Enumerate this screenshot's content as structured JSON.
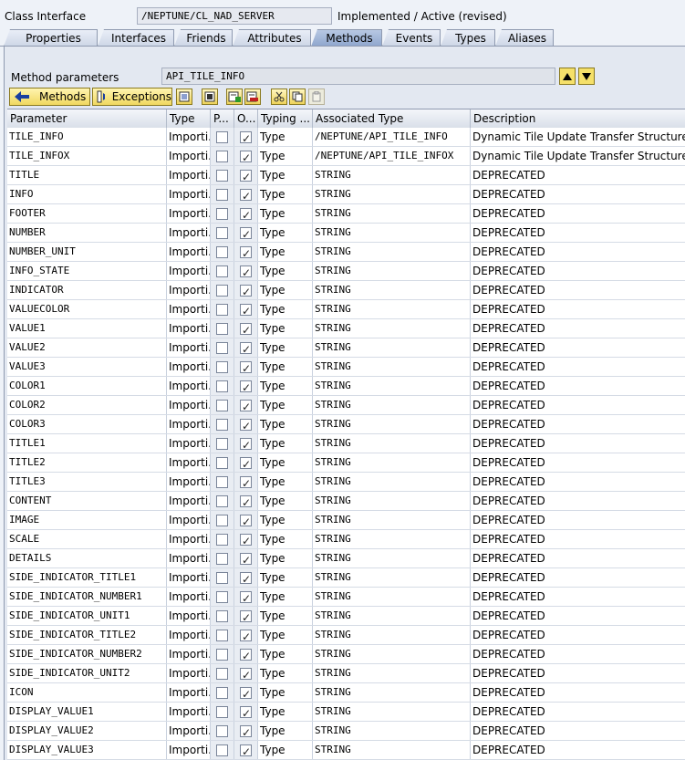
{
  "header": {
    "class_label": "Class Interface",
    "class_value": "/NEPTUNE/CL_NAD_SERVER",
    "status": "Implemented / Active (revised)"
  },
  "tabs": [
    {
      "label": "Properties"
    },
    {
      "label": "Interfaces"
    },
    {
      "label": "Friends"
    },
    {
      "label": "Attributes"
    },
    {
      "label": "Methods",
      "active": true
    },
    {
      "label": "Events"
    },
    {
      "label": "Types"
    },
    {
      "label": "Aliases"
    }
  ],
  "method_params": {
    "label": "Method parameters",
    "value": "API_TILE_INFO"
  },
  "toolbar": {
    "methods_label": "Methods",
    "exceptions_label": "Exceptions"
  },
  "columns": [
    "Parameter",
    "Type",
    "P...",
    "O...",
    "Typing ...",
    "Associated Type",
    "Description"
  ],
  "rows": [
    {
      "p": "TILE_INFO",
      "t": "Importi...",
      "pass": false,
      "opt": true,
      "typing": "Type",
      "assoc": "/NEPTUNE/API_TILE_INFO",
      "desc": "Dynamic Tile Update Transfer Structure"
    },
    {
      "p": "TILE_INFOX",
      "t": "Importi...",
      "pass": false,
      "opt": true,
      "typing": "Type",
      "assoc": "/NEPTUNE/API_TILE_INFOX",
      "desc": "Dynamic Tile Update Transfer Structure"
    },
    {
      "p": "TITLE",
      "t": "Importi...",
      "pass": false,
      "opt": true,
      "typing": "Type",
      "assoc": "STRING",
      "desc": "DEPRECATED"
    },
    {
      "p": "INFO",
      "t": "Importi...",
      "pass": false,
      "opt": true,
      "typing": "Type",
      "assoc": "STRING",
      "desc": "DEPRECATED"
    },
    {
      "p": "FOOTER",
      "t": "Importi...",
      "pass": false,
      "opt": true,
      "typing": "Type",
      "assoc": "STRING",
      "desc": "DEPRECATED"
    },
    {
      "p": "NUMBER",
      "t": "Importi...",
      "pass": false,
      "opt": true,
      "typing": "Type",
      "assoc": "STRING",
      "desc": "DEPRECATED"
    },
    {
      "p": "NUMBER_UNIT",
      "t": "Importi...",
      "pass": false,
      "opt": true,
      "typing": "Type",
      "assoc": "STRING",
      "desc": "DEPRECATED"
    },
    {
      "p": "INFO_STATE",
      "t": "Importi...",
      "pass": false,
      "opt": true,
      "typing": "Type",
      "assoc": "STRING",
      "desc": "DEPRECATED"
    },
    {
      "p": "INDICATOR",
      "t": "Importi...",
      "pass": false,
      "opt": true,
      "typing": "Type",
      "assoc": "STRING",
      "desc": "DEPRECATED"
    },
    {
      "p": "VALUECOLOR",
      "t": "Importi...",
      "pass": false,
      "opt": true,
      "typing": "Type",
      "assoc": "STRING",
      "desc": "DEPRECATED"
    },
    {
      "p": "VALUE1",
      "t": "Importi...",
      "pass": false,
      "opt": true,
      "typing": "Type",
      "assoc": "STRING",
      "desc": "DEPRECATED"
    },
    {
      "p": "VALUE2",
      "t": "Importi...",
      "pass": false,
      "opt": true,
      "typing": "Type",
      "assoc": "STRING",
      "desc": "DEPRECATED"
    },
    {
      "p": "VALUE3",
      "t": "Importi...",
      "pass": false,
      "opt": true,
      "typing": "Type",
      "assoc": "STRING",
      "desc": "DEPRECATED"
    },
    {
      "p": "COLOR1",
      "t": "Importi...",
      "pass": false,
      "opt": true,
      "typing": "Type",
      "assoc": "STRING",
      "desc": "DEPRECATED"
    },
    {
      "p": "COLOR2",
      "t": "Importi...",
      "pass": false,
      "opt": true,
      "typing": "Type",
      "assoc": "STRING",
      "desc": "DEPRECATED"
    },
    {
      "p": "COLOR3",
      "t": "Importi...",
      "pass": false,
      "opt": true,
      "typing": "Type",
      "assoc": "STRING",
      "desc": "DEPRECATED"
    },
    {
      "p": "TITLE1",
      "t": "Importi...",
      "pass": false,
      "opt": true,
      "typing": "Type",
      "assoc": "STRING",
      "desc": "DEPRECATED"
    },
    {
      "p": "TITLE2",
      "t": "Importi...",
      "pass": false,
      "opt": true,
      "typing": "Type",
      "assoc": "STRING",
      "desc": "DEPRECATED"
    },
    {
      "p": "TITLE3",
      "t": "Importi...",
      "pass": false,
      "opt": true,
      "typing": "Type",
      "assoc": "STRING",
      "desc": "DEPRECATED"
    },
    {
      "p": "CONTENT",
      "t": "Importi...",
      "pass": false,
      "opt": true,
      "typing": "Type",
      "assoc": "STRING",
      "desc": "DEPRECATED"
    },
    {
      "p": "IMAGE",
      "t": "Importi...",
      "pass": false,
      "opt": true,
      "typing": "Type",
      "assoc": "STRING",
      "desc": "DEPRECATED"
    },
    {
      "p": "SCALE",
      "t": "Importi...",
      "pass": false,
      "opt": true,
      "typing": "Type",
      "assoc": "STRING",
      "desc": "DEPRECATED"
    },
    {
      "p": "DETAILS",
      "t": "Importi...",
      "pass": false,
      "opt": true,
      "typing": "Type",
      "assoc": "STRING",
      "desc": "DEPRECATED"
    },
    {
      "p": "SIDE_INDICATOR_TITLE1",
      "t": "Importi...",
      "pass": false,
      "opt": true,
      "typing": "Type",
      "assoc": "STRING",
      "desc": "DEPRECATED"
    },
    {
      "p": "SIDE_INDICATOR_NUMBER1",
      "t": "Importi...",
      "pass": false,
      "opt": true,
      "typing": "Type",
      "assoc": "STRING",
      "desc": "DEPRECATED"
    },
    {
      "p": "SIDE_INDICATOR_UNIT1",
      "t": "Importi...",
      "pass": false,
      "opt": true,
      "typing": "Type",
      "assoc": "STRING",
      "desc": "DEPRECATED"
    },
    {
      "p": "SIDE_INDICATOR_TITLE2",
      "t": "Importi...",
      "pass": false,
      "opt": true,
      "typing": "Type",
      "assoc": "STRING",
      "desc": "DEPRECATED"
    },
    {
      "p": "SIDE_INDICATOR_NUMBER2",
      "t": "Importi...",
      "pass": false,
      "opt": true,
      "typing": "Type",
      "assoc": "STRING",
      "desc": "DEPRECATED"
    },
    {
      "p": "SIDE_INDICATOR_UNIT2",
      "t": "Importi...",
      "pass": false,
      "opt": true,
      "typing": "Type",
      "assoc": "STRING",
      "desc": "DEPRECATED"
    },
    {
      "p": "ICON",
      "t": "Importi...",
      "pass": false,
      "opt": true,
      "typing": "Type",
      "assoc": "STRING",
      "desc": "DEPRECATED"
    },
    {
      "p": "DISPLAY_VALUE1",
      "t": "Importi...",
      "pass": false,
      "opt": true,
      "typing": "Type",
      "assoc": "STRING",
      "desc": "DEPRECATED"
    },
    {
      "p": "DISPLAY_VALUE2",
      "t": "Importi...",
      "pass": false,
      "opt": true,
      "typing": "Type",
      "assoc": "STRING",
      "desc": "DEPRECATED"
    },
    {
      "p": "DISPLAY_VALUE3",
      "t": "Importi...",
      "pass": false,
      "opt": true,
      "typing": "Type",
      "assoc": "STRING",
      "desc": "DEPRECATED"
    }
  ],
  "icons": {
    "back": "arrow-left-icon",
    "exceptions": "exceptions-icon",
    "up": "triangle-up-icon",
    "down": "triangle-down-icon"
  },
  "colors": {
    "active_tab": "#8ea6cd",
    "button_yellow": "#f0d860",
    "panel_bg": "#e3e8f1"
  }
}
